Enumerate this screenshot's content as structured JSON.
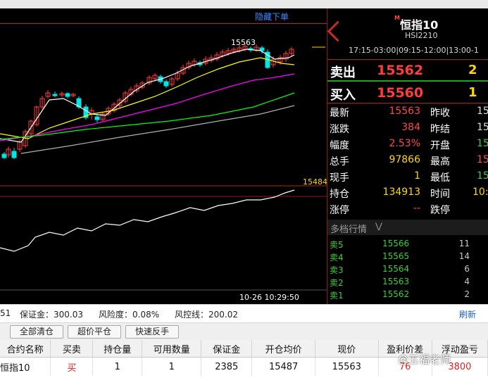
{
  "chart": {
    "hide_order_label": "隐藏下单",
    "high_label": "15563",
    "right_price_label": "15484",
    "time_label": "10-26 10:29:50"
  },
  "quote": {
    "main_badge": "M",
    "name": "恒指10",
    "code": "HSI2210",
    "sessions": "17:15-03:00|09:15-12:00|13:00-1",
    "sell_label": "卖出",
    "sell_price": "15562",
    "sell_qty": "2",
    "buy_label": "买入",
    "buy_price": "15560",
    "buy_qty": "1",
    "stats": [
      {
        "label": "最新",
        "value": "15563",
        "right_label": "昨收",
        "right_value": "15"
      },
      {
        "label": "涨跌",
        "value": "384",
        "right_label": "昨结",
        "right_value": "15"
      },
      {
        "label": "幅度",
        "value": "2.53%",
        "right_label": "开盘",
        "right_value": "15"
      },
      {
        "label": "总手",
        "value": "97866",
        "right_label": "最高",
        "right_value": "15"
      },
      {
        "label": "现手",
        "value": "1",
        "right_label": "最低",
        "right_value": "15"
      },
      {
        "label": "持仓",
        "value": "134913",
        "right_label": "时间",
        "right_value": "10:3"
      },
      {
        "label": "涨停",
        "value": "--",
        "right_label": "跌停",
        "right_value": ""
      }
    ],
    "depth_title": "多档行情",
    "depth": [
      {
        "label": "卖5",
        "price": "15566",
        "qty": "11"
      },
      {
        "label": "卖4",
        "price": "15565",
        "qty": "14"
      },
      {
        "label": "卖3",
        "price": "15564",
        "qty": "6"
      },
      {
        "label": "卖2",
        "price": "15563",
        "qty": "4"
      },
      {
        "label": "卖1",
        "price": "15562",
        "qty": "2"
      }
    ]
  },
  "account": {
    "left_fragment": "51",
    "margin": "保证金：300.03",
    "risk": "风险度：0.08%",
    "stop_line": "风控线：200.02",
    "refresh": "刷新"
  },
  "buttons": {
    "close_all": "全部清仓",
    "super_close": "超价平仓",
    "quick_reverse": "快速反手"
  },
  "positions": {
    "headers": [
      "合约名称",
      "买卖",
      "持仓量",
      "可用数量",
      "保证金",
      "开仓均价",
      "现价",
      "盈利价差",
      "浮动盈亏"
    ],
    "rows": [
      [
        "恒指10",
        "买",
        "1",
        "1",
        "2385",
        "15487",
        "15563",
        "76",
        "3800"
      ]
    ]
  },
  "watermark": "@五福老师",
  "colors": {
    "up": "#ff3d3d",
    "down": "#00e5e5",
    "ma_fast": "#ffffff",
    "ma_mid": "#ffff00",
    "ma_slow": "#ff00ff",
    "ma_long": "#00ff00",
    "ma_xlong": "#b0b0b0"
  }
}
